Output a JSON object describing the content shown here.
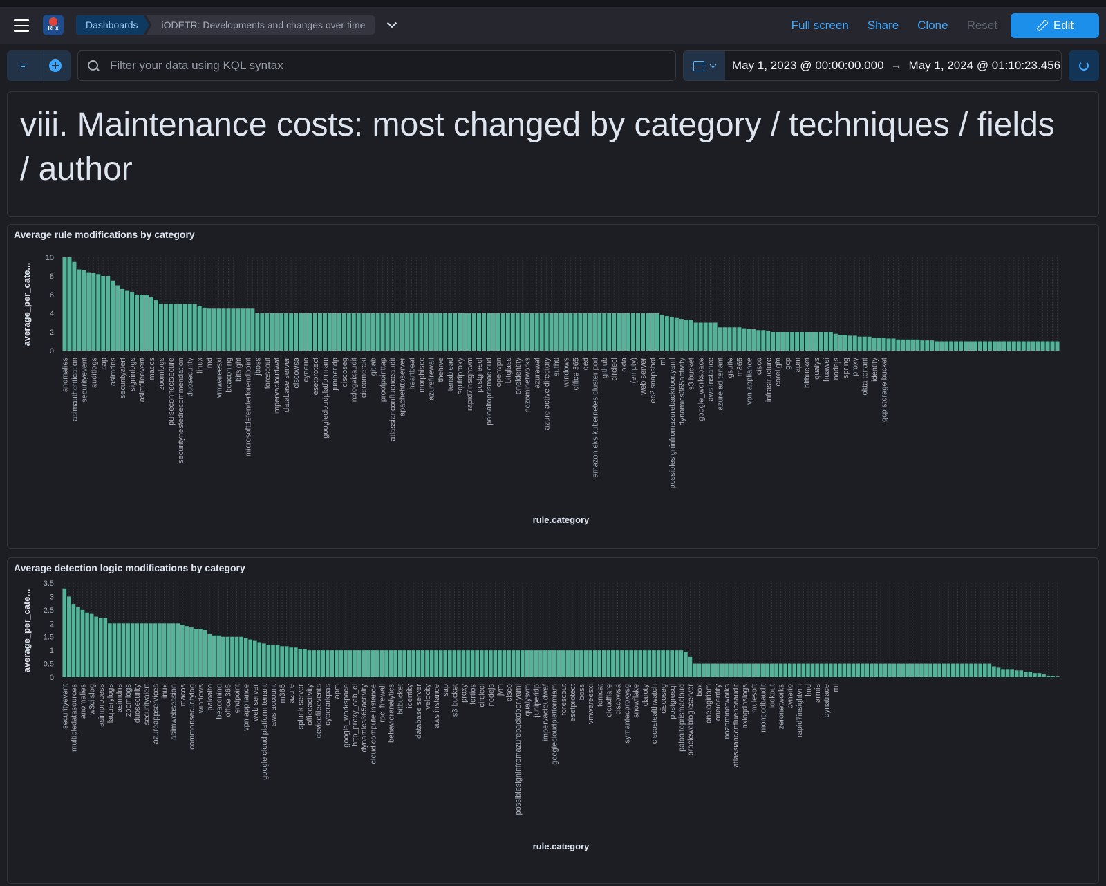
{
  "topbar": {
    "breadcrumbs": [
      "Dashboards",
      "iODETR: Developments and changes over time"
    ],
    "actions": {
      "fullscreen": "Full screen",
      "share": "Share",
      "clone": "Clone",
      "reset": "Reset",
      "edit": "Edit"
    },
    "logo_text": "RFx"
  },
  "query": {
    "placeholder": "Filter your data using KQL syntax",
    "date_start": "May 1, 2023 @ 00:00:00.000",
    "date_end": "May 1, 2024 @ 01:10:23.456"
  },
  "markdown": {
    "title": "viii. Maintenance costs: most changed by category / techniques / fields / author"
  },
  "colors": {
    "bar": "#54b399",
    "accent": "#1c8fea",
    "link": "#3ea7ff"
  },
  "chart_data": [
    {
      "type": "bar",
      "title": "Average rule modifications by category",
      "xlabel": "rule.category",
      "ylabel": "average_per_cate...",
      "ylim": [
        0,
        10
      ],
      "yticks": [
        0,
        2,
        4,
        6,
        8,
        10
      ],
      "grid": "vertical",
      "labeled_categories": [
        "anomalies",
        "asimauthentication",
        "securityevent",
        "auditlogs",
        "sap",
        "asimdns",
        "securityalert",
        "signinlogs",
        "asimfileevent",
        "macos",
        "zoomlogs",
        "pulseconnectsecure",
        "securitynestedrecommendation",
        "duosecurity",
        "linux",
        "lmd",
        "vmwareesxi",
        "beaconing",
        "bitsight",
        "microsoftdefenderforendpoint",
        "jboss",
        "forescout",
        "impervacloudwaf",
        "database server",
        "ciscowsa",
        "cynerio",
        "esetprotect",
        "googlecloudplatformiam",
        "juniperidp",
        "ciscoseg",
        "nxlogaixaudit",
        "ciscomeraki",
        "gitlab",
        "proofpointtap",
        "atlassianconfluenceaudit",
        "apachehttpserver",
        "heartbeat",
        "morphisec",
        "azurefirewall",
        "thehive",
        "tenablead",
        "squidproxy",
        "rapid7insightvm",
        "postgresql",
        "paloaltoprismacloud",
        "openvpn",
        "bitglass",
        "oneidentity",
        "nozominetworks",
        "azurewaf",
        "azure active directory",
        "auth0",
        "windows",
        "office 365",
        "ded",
        "amazon eks kubernetes cluster pod",
        "github",
        "circleci",
        "okta",
        "(empty)",
        "web server",
        "ec2 snapshot",
        "ml",
        "possiblesigninfromazurebackdoor.yaml",
        "dynamics365activity",
        "s3 bucket",
        "google_workspace",
        "aws instance",
        "azure ad tenant",
        "gsuite",
        "m365",
        "vpn appliance",
        "cisco",
        "infrastructure",
        "corelight",
        "gcp",
        "apm",
        "bitbucket",
        "qualys",
        "huawei",
        "nodejs",
        "spring",
        "proxy",
        "okta tenant",
        "identity",
        "gcp storage bucket"
      ],
      "values": [
        10,
        10,
        9.5,
        8.7,
        8.6,
        8.4,
        8.3,
        8.2,
        8,
        8,
        7.5,
        7,
        6.6,
        6.4,
        6.3,
        6,
        6,
        6,
        5.7,
        5.4,
        5,
        5,
        5,
        5,
        5,
        5,
        5,
        5,
        4.8,
        4.6,
        4.5,
        4.5,
        4.5,
        4.5,
        4.5,
        4.5,
        4.5,
        4.5,
        4.5,
        4.5,
        4,
        4,
        4,
        4,
        4,
        4,
        4,
        4,
        4,
        4,
        4,
        4,
        4,
        4,
        4,
        4,
        4,
        4,
        4,
        4,
        4,
        4,
        4,
        4,
        4,
        4,
        4,
        4,
        4,
        4,
        4,
        4,
        4,
        4,
        4,
        4,
        4,
        4,
        4,
        4,
        4,
        4,
        4,
        4,
        4,
        4,
        4,
        4,
        4,
        4,
        4,
        4,
        4,
        4,
        4,
        4,
        4,
        4,
        4,
        4,
        4,
        4,
        4,
        4,
        4,
        4,
        4,
        4,
        4,
        4,
        4,
        4,
        4,
        4,
        4,
        4,
        4,
        4,
        4,
        4,
        4,
        4,
        4,
        4,
        3.8,
        3.7,
        3.6,
        3.5,
        3.4,
        3.3,
        3.3,
        3,
        3,
        3,
        3,
        3,
        2.5,
        2.5,
        2.5,
        2.5,
        2.5,
        2.4,
        2.3,
        2.3,
        2.2,
        2.2,
        2.1,
        2,
        2,
        2,
        2,
        2,
        2,
        2,
        2,
        2,
        2,
        2,
        2,
        2,
        1.8,
        1.7,
        1.7,
        1.6,
        1.6,
        1.5,
        1.5,
        1.5,
        1.4,
        1.4,
        1.4,
        1.3,
        1.3,
        1.2,
        1.2,
        1.2,
        1.2,
        1.2,
        1.1,
        1.1,
        1.1,
        1,
        1,
        1,
        1,
        1,
        1,
        1,
        1,
        1,
        1,
        1,
        1,
        1,
        1,
        1,
        1,
        1,
        1,
        1,
        1,
        1,
        1,
        1,
        1,
        1,
        1
      ]
    },
    {
      "type": "bar",
      "title": "Average detection logic modifications by category",
      "xlabel": "rule.category",
      "ylabel": "average_per_cate...",
      "ylim": [
        0,
        3.5
      ],
      "yticks": [
        0,
        0.5,
        1,
        1.5,
        2,
        2.5,
        3,
        3.5
      ],
      "grid": "vertical",
      "labeled_categories": [
        "securityevent",
        "multipledatasources",
        "anomalies",
        "w3ciislog",
        "asimprocess",
        "laquerylogs",
        "asimdns",
        "zoomlogs",
        "duosecurity",
        "securityalert",
        "azureappservices",
        "linux",
        "asimwebsession",
        "macos",
        "commonsecuritylog",
        "windows",
        "paloalto",
        "beaconing",
        "office 365",
        "endpoint",
        "vpn appliance",
        "web server",
        "google cloud platform tenant",
        "aws account",
        "m365",
        "azure",
        "splunk server",
        "officeactivity",
        "devicefileevents",
        "cyberarkpas",
        "apm",
        "google_workspace",
        "http_proxy_oab_cl",
        "dynamics365activity",
        "cloud compute instance",
        "rpc_firewall",
        "behavioranalytics",
        "bitbucket",
        "identity",
        "database server",
        "velocity",
        "aws instance",
        "sap",
        "s3 bucket",
        "proxy",
        "fortios",
        "circleci",
        "nodejs",
        "jvm",
        "cisco",
        "possiblesigninfromazurebackdoor.yaml",
        "qualysvm",
        "juniperidp",
        "impervacloudwaf",
        "googlecloudplatformiam",
        "forescout",
        "esetprotect",
        "iboss",
        "vmwareesxi",
        "tomcat",
        "cloudflare",
        "ciscowsa",
        "symantecproxysg",
        "snowflake",
        "claroty",
        "ciscostealthwatch",
        "ciscoseg",
        "postgresql",
        "paloaltoprismacloud",
        "oracleweblogicserver",
        "box",
        "onelogiriam",
        "oneidentity",
        "nozominetworks",
        "atlassianconfluenceaudit",
        "nxlogdnslogs",
        "mulesoft",
        "mongodbaudit",
        "lookout",
        "zeronetworks",
        "cynerio",
        "rapid7insightvm",
        "lmd",
        "armis",
        "dynatrace",
        "ml"
      ],
      "values": [
        3.3,
        3,
        2.7,
        2.6,
        2.5,
        2.4,
        2.35,
        2.25,
        2.2,
        2.2,
        2,
        2,
        2,
        2,
        2,
        2,
        2,
        2,
        2,
        2,
        2,
        2,
        2,
        2,
        2,
        2,
        1.95,
        1.9,
        1.85,
        1.8,
        1.8,
        1.75,
        1.6,
        1.55,
        1.55,
        1.5,
        1.5,
        1.5,
        1.5,
        1.5,
        1.45,
        1.4,
        1.35,
        1.3,
        1.25,
        1.2,
        1.2,
        1.2,
        1.15,
        1.15,
        1.1,
        1.1,
        1.05,
        1.05,
        1,
        1,
        1,
        1,
        1,
        1,
        1,
        1,
        1,
        1,
        1,
        1,
        1,
        1,
        1,
        1,
        1,
        1,
        1,
        1,
        1,
        1,
        1,
        1,
        1,
        1,
        1,
        1,
        1,
        1,
        1,
        1,
        1,
        1,
        1,
        1,
        1,
        1,
        1,
        1,
        1,
        1,
        1,
        1,
        1,
        1,
        1,
        1,
        1,
        1,
        1,
        1,
        1,
        1,
        1,
        1,
        1,
        1,
        1,
        1,
        1,
        1,
        1,
        1,
        1,
        1,
        1,
        1,
        1,
        1,
        1,
        1,
        1,
        1,
        1,
        1,
        1,
        1,
        1,
        1,
        1,
        1,
        1,
        0.95,
        0.75,
        0.5,
        0.5,
        0.5,
        0.5,
        0.5,
        0.5,
        0.5,
        0.5,
        0.5,
        0.5,
        0.5,
        0.5,
        0.5,
        0.5,
        0.5,
        0.5,
        0.5,
        0.5,
        0.5,
        0.5,
        0.5,
        0.5,
        0.5,
        0.5,
        0.5,
        0.5,
        0.5,
        0.5,
        0.5,
        0.5,
        0.5,
        0.5,
        0.5,
        0.5,
        0.5,
        0.5,
        0.5,
        0.5,
        0.5,
        0.5,
        0.5,
        0.5,
        0.5,
        0.5,
        0.5,
        0.5,
        0.5,
        0.5,
        0.5,
        0.5,
        0.5,
        0.5,
        0.5,
        0.5,
        0.5,
        0.5,
        0.5,
        0.5,
        0.5,
        0.5,
        0.5,
        0.5,
        0.5,
        0.5,
        0.5,
        0.5,
        0.4,
        0.35,
        0.3,
        0.3,
        0.3,
        0.25,
        0.25,
        0.2,
        0.2,
        0.15,
        0.15,
        0.1,
        0.05,
        0.05,
        0.02
      ]
    }
  ]
}
